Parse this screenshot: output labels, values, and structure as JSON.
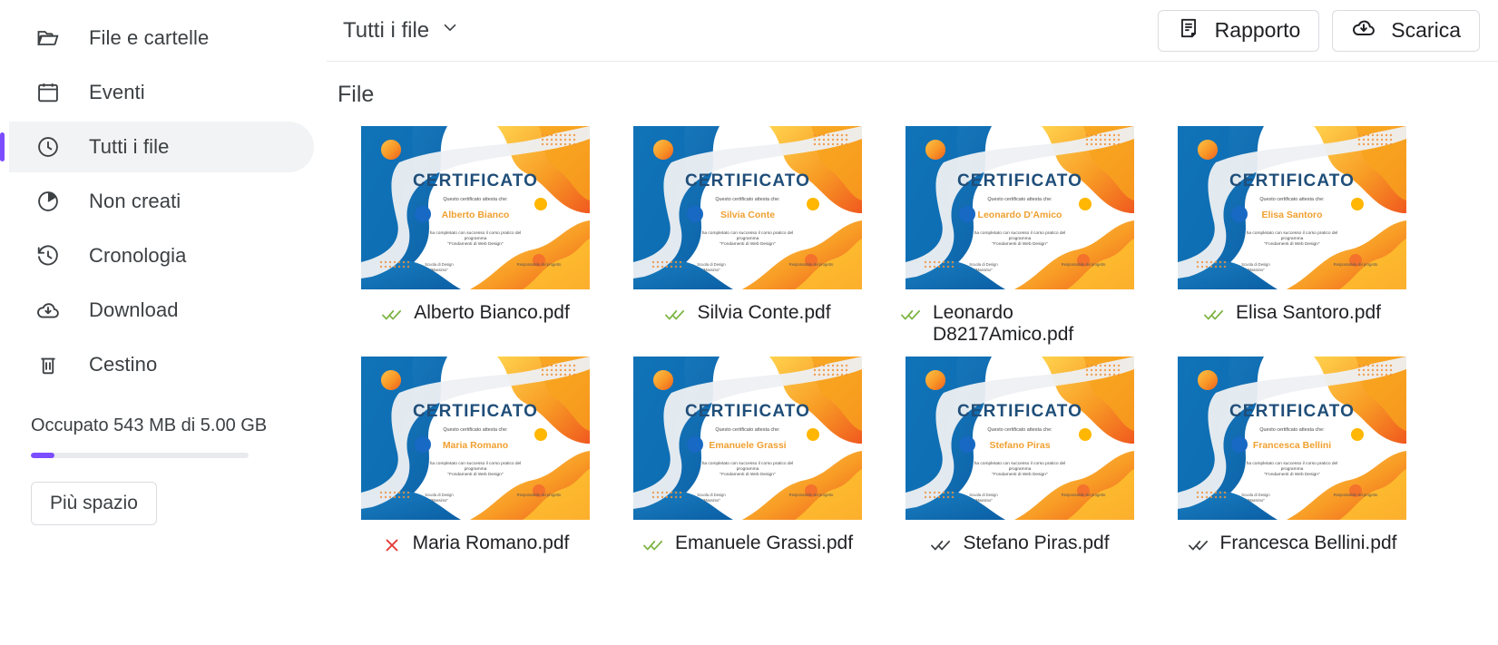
{
  "sidebar": {
    "items": [
      {
        "label": "File e cartelle",
        "icon": "folder-icon",
        "active": false
      },
      {
        "label": "Eventi",
        "icon": "calendar-icon",
        "active": false
      },
      {
        "label": "Tutti i file",
        "icon": "clock-icon",
        "active": true
      },
      {
        "label": "Non creati",
        "icon": "pie-chart-icon",
        "active": false
      },
      {
        "label": "Cronologia",
        "icon": "history-icon",
        "active": false
      },
      {
        "label": "Download",
        "icon": "cloud-download-icon",
        "active": false
      },
      {
        "label": "Cestino",
        "icon": "trash-icon",
        "active": false
      }
    ],
    "storage": {
      "text": "Occupato 543 MB di 5.00 GB",
      "used_percent": 11,
      "bar_color": "#7c4dff",
      "more_space_label": "Più spazio"
    }
  },
  "topbar": {
    "filter_label": "Tutti i file",
    "filter_icon": "chevron-down-icon",
    "report_label": "Rapporto",
    "report_icon": "document-icon",
    "download_label": "Scarica",
    "download_icon": "cloud-download-icon"
  },
  "main": {
    "section_title": "File"
  },
  "certificate": {
    "heading": "CERTIFICATO",
    "subheading": "Questo certificato attesta che:",
    "body_line1": "ha completato con successo il corso pratico del",
    "body_line2": "programma",
    "body_line3": "\"Fondamenti di Web Design\"",
    "footer_left_line1": "Scuola di Design",
    "footer_left_line2": "\"Massimo\"",
    "footer_right": "Responsabile del progetto",
    "heading_color": "#1f4e79",
    "name_color": "#f0a030"
  },
  "files": [
    {
      "filename": "Alberto Bianco.pdf",
      "recipient": "Alberto Bianco",
      "status": "double-check",
      "status_color": "#7cb342"
    },
    {
      "filename": "Silvia Conte.pdf",
      "recipient": "Silvia Conte",
      "status": "double-check",
      "status_color": "#7cb342"
    },
    {
      "filename": "Leonardo D8217Amico.pdf",
      "recipient": "Leonardo D'Amico",
      "status": "double-check",
      "status_color": "#7cb342"
    },
    {
      "filename": "Elisa Santoro.pdf",
      "recipient": "Elisa Santoro",
      "status": "double-check",
      "status_color": "#7cb342"
    },
    {
      "filename": "Maria Romano.pdf",
      "recipient": "Maria Romano",
      "status": "cross",
      "status_color": "#e53935"
    },
    {
      "filename": "Emanuele Grassi.pdf",
      "recipient": "Emanuele Grassi",
      "status": "double-check",
      "status_color": "#7cb342"
    },
    {
      "filename": "Stefano Piras.pdf",
      "recipient": "Stefano Piras",
      "status": "double-check",
      "status_color": "#3c4043"
    },
    {
      "filename": "Francesca Bellini.pdf",
      "recipient": "Francesca Bellini",
      "status": "double-check",
      "status_color": "#3c4043"
    }
  ]
}
